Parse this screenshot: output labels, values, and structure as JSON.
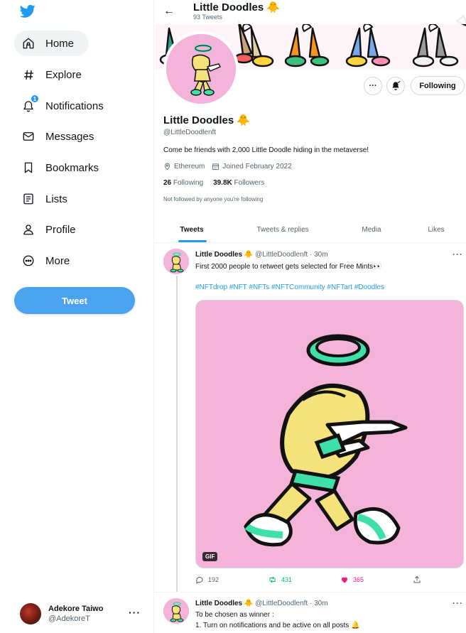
{
  "sidebar": {
    "items": [
      {
        "label": "Home",
        "icon": "home-icon"
      },
      {
        "label": "Explore",
        "icon": "hashtag-icon"
      },
      {
        "label": "Notifications",
        "icon": "bell-icon",
        "badge": "1"
      },
      {
        "label": "Messages",
        "icon": "envelope-icon"
      },
      {
        "label": "Bookmarks",
        "icon": "bookmark-icon"
      },
      {
        "label": "Lists",
        "icon": "list-icon"
      },
      {
        "label": "Profile",
        "icon": "person-icon"
      },
      {
        "label": "More",
        "icon": "more-circle-icon"
      }
    ],
    "tweet_button": "Tweet",
    "account": {
      "name": "Adekore Taiwo",
      "handle": "@AdekoreT",
      "more": "···"
    }
  },
  "header": {
    "title": "Little Doodles 🐥",
    "subtitle": "93 Tweets",
    "back": "←"
  },
  "profile": {
    "name": "Little Doodles 🐥",
    "handle": "@LittleDoodlenft",
    "bio": "Come be friends with 2,000 Little Doodle hiding in the metaverse!",
    "location": "Ethereum",
    "joined": "Joined February 2022",
    "following_count": "26",
    "following_label": "Following",
    "followers_count": "39.8K",
    "followers_label": "Followers",
    "not_followed": "Not followed by anyone you're following",
    "more_button": "···",
    "following_button": "Following"
  },
  "tabs": [
    {
      "label": "Tweets",
      "active": true
    },
    {
      "label": "Tweets & replies",
      "active": false
    },
    {
      "label": "Media",
      "active": false
    },
    {
      "label": "Likes",
      "active": false
    }
  ],
  "tweets": [
    {
      "name": "Little Doodles 🐥",
      "handle": "@LittleDoodlenft",
      "time": "· 30m",
      "text": "First 2000 people to retweet gets selected for Free Mints👀",
      "tags": "#NFTdrop #NFT #NFTs #NFTCommunity #NFTart #Doodles",
      "media_badge": "GIF",
      "replies": "192",
      "retweets": "431",
      "likes": "365",
      "more": "···"
    },
    {
      "name": "Little Doodles 🐥",
      "handle": "@LittleDoodlenft",
      "time": "· 30m",
      "line1": "To be chosen as winner :",
      "line2": "1. Turn on notifications and be active on all posts 🔔",
      "more": "···"
    }
  ],
  "colors": {
    "accent": "#1d9bf0",
    "retweet": "#00ba7c",
    "like": "#f91880",
    "avatar_bg": "#f4b3d8"
  }
}
